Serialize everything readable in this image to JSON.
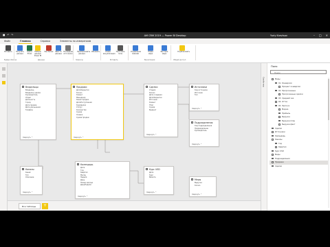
{
  "window": {
    "title": "AM CRM 2019 — Power BI Desktop",
    "user": "Yuriy Kravtsov"
  },
  "ribbon_tabs": [
    "Файл",
    "Главная",
    "Справка",
    "Элементы по измерениям"
  ],
  "ribbon_buttons": [
    {
      "label": "Вставить",
      "color": "#4a4a4a"
    },
    {
      "label": "Получить данные",
      "color": "#3a7bd5"
    },
    {
      "label": "Книга Excel",
      "color": "#217346"
    },
    {
      "label": "Наборы данных Power BI",
      "color": "#f2c811"
    },
    {
      "label": "SQL Server",
      "color": "#c0392b"
    },
    {
      "label": "Ввести данные",
      "color": "#3a7bd5"
    },
    {
      "label": "Последние источники",
      "color": "#777777"
    },
    {
      "label": "Преобразовать данные",
      "color": "#3a7bd5"
    },
    {
      "label": "Обновить",
      "color": "#3a7bd5"
    },
    {
      "label": "Новая визуализация",
      "color": "#3a7bd5"
    },
    {
      "label": "Текстовое поле",
      "color": "#555555"
    },
    {
      "label": "Управление связями",
      "color": "#3a7bd5"
    },
    {
      "label": "Новая мера",
      "color": "#3a7bd5"
    },
    {
      "label": "Быстрая мера",
      "color": "#3a7bd5"
    },
    {
      "label": "Опубликовать",
      "color": "#f2c811"
    }
  ],
  "ribbon_groups": [
    "Буфер обмена",
    "Данные",
    "Запросы",
    "Вставить",
    "Вычисления",
    "Общий доступ"
  ],
  "tables": [
    {
      "name": "Владельцы",
      "fields": [
        "Владелец",
        "Владелец сделки",
        "Руководитель",
        "Отдел",
        "Должность",
        "Город",
        "Дата приема",
        "Дата увольнения",
        "Телефон"
      ],
      "footer": "Свернуть ^"
    },
    {
      "name": "Продажи",
      "fields": [
        "ДатаЗакрытия",
        "Кол-во",
        "Клиент",
        "Менеджер",
        "Канал продаж",
        "ДатаПоступления",
        "КодСделки",
        "Статус",
        "Количество",
        "Сумма",
        "Скидка",
        "Сумма продаж"
      ],
      "footer": "Свернуть ^"
    },
    {
      "name": "Сделки",
      "fields": [
        "Стадия",
        "Кол-во",
        "Дата создания",
        "ДатаЗакрытия",
        "Источник",
        "Клиент",
        "Этап",
        "Сумма",
        "Бюджет"
      ],
      "footer": "Свернуть ^"
    },
    {
      "name": "Источники",
      "fields": [
        "Код источника",
        "Источник",
        "Тип"
      ],
      "footer": "Свернуть ^"
    },
    {
      "name": "Подразделения",
      "fields": [
        "Код подразделения",
        "Подразделение",
        "Руководитель"
      ],
      "footer": "Свернуть ^"
    },
    {
      "name": "Каналы",
      "fields": [
        "Канал",
        "Тип",
        "Описание"
      ],
      "footer": "Свернуть ^"
    },
    {
      "name": "Календарь",
      "fields": [
        "Дата",
        "Год",
        "Квартал",
        "Месяц",
        "Неделя",
        "День",
        "Номер месяца",
        "ДеньНедели"
      ],
      "footer": "Свернуть ^"
    },
    {
      "name": "Курс USD",
      "fields": [
        "Дата",
        "Курс",
        "Валюта"
      ],
      "footer": "Свернуть ^"
    },
    {
      "name": "Меры",
      "fields": [
        "Выручка",
        "Кол-во"
      ],
      "footer": "Свернуть ^"
    }
  ],
  "page_tab": "Все таблицы",
  "fields_pane": {
    "vertical_tab": "Свойства",
    "title": "Поля",
    "search_placeholder": "Поиск",
    "items": [
      "Меры",
      "01. Конверсия",
      "Процент конверсии",
      "02. Просроченные",
      "Просроченные сделки",
      "03. Средний чек",
      "04. Отток",
      "05. Прогноз",
      "Маржа",
      "Прибыль",
      "Выручка",
      "Выручка план",
      "Выручка факт",
      "Сделки",
      "Источники",
      "Календарь",
      "Каналы",
      "Год",
      "Квартал",
      "Курс USD",
      "Меры",
      "Подразделения",
      "Продажи",
      "Сделки"
    ]
  },
  "colors": {
    "accent": "#f2c811",
    "titlebar": "#2b2b2b",
    "canvas": "#e9e9e9"
  }
}
